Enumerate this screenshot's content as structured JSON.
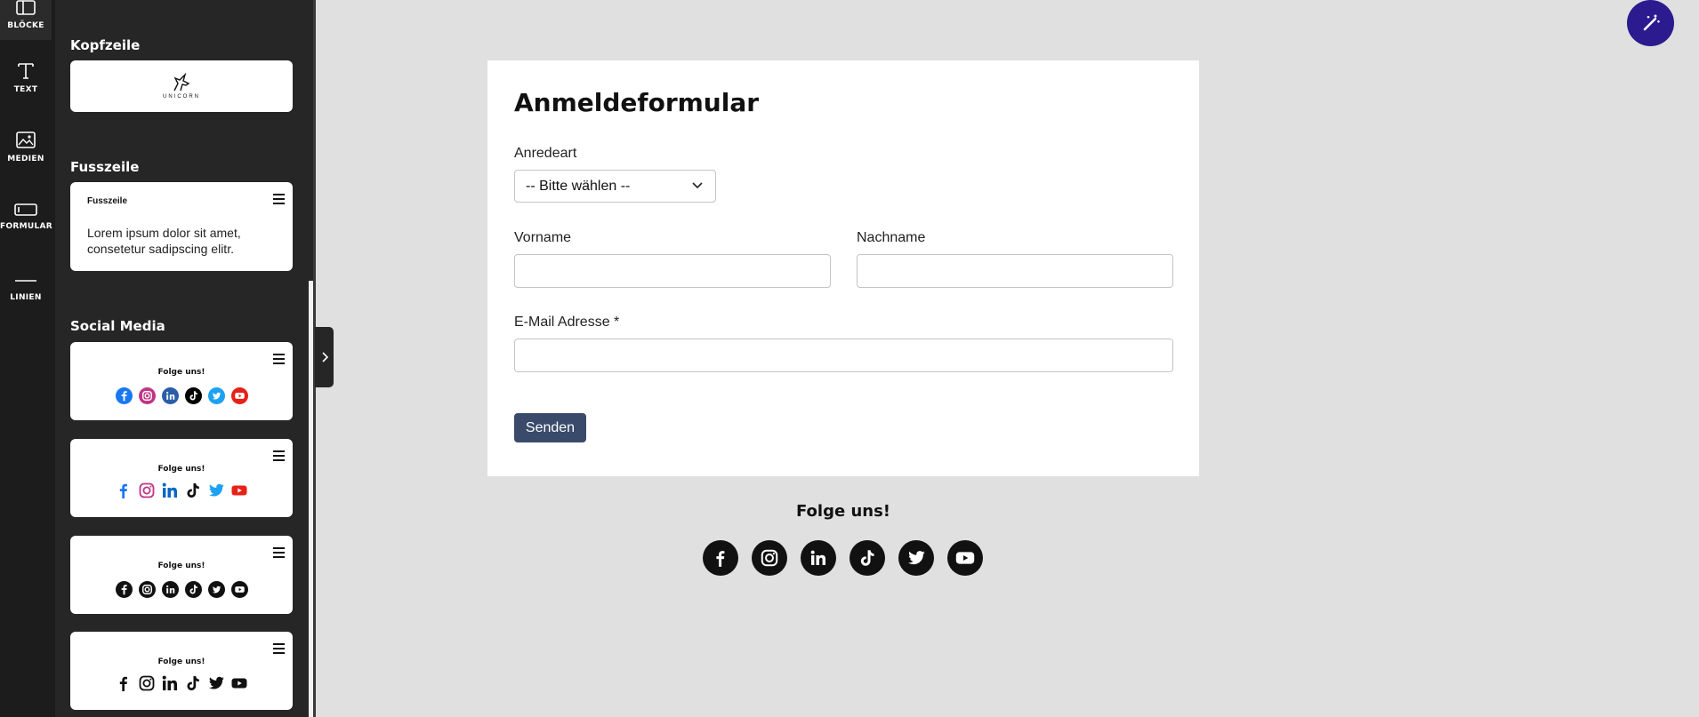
{
  "rail": {
    "items": [
      {
        "label": "BLÖCKE",
        "icon": "blocks-icon"
      },
      {
        "label": "TEXT",
        "icon": "text-icon"
      },
      {
        "label": "MEDIEN",
        "icon": "image-icon"
      },
      {
        "label": "FORMULAR",
        "icon": "form-icon"
      },
      {
        "label": "LINIEN",
        "icon": "line-icon"
      }
    ]
  },
  "panel": {
    "header_section": {
      "title": "Kopfzeile",
      "logo_text": "UNICORN"
    },
    "footer_section": {
      "title": "Fusszeile",
      "card_title": "Fusszeile",
      "card_text": "Lorem ipsum dolor sit amet, consetetur sadipscing elitr."
    },
    "social_section": {
      "title": "Social Media",
      "cards": [
        {
          "label": "Folge uns!",
          "style": "color-circle"
        },
        {
          "label": "Folge uns!",
          "style": "color-plain"
        },
        {
          "label": "Folge uns!",
          "style": "black-circle"
        },
        {
          "label": "Folge uns!",
          "style": "black-plain"
        }
      ]
    }
  },
  "form": {
    "title": "Anmeldeformular",
    "salutation_label": "Anredeart",
    "salutation_value": "-- Bitte wählen --",
    "firstname_label": "Vorname",
    "lastname_label": "Nachname",
    "email_label": "E-Mail Adresse *",
    "submit_label": "Senden"
  },
  "follow": {
    "title": "Folge uns!"
  },
  "colors": {
    "facebook": "#1877f2",
    "instagram": "#c13584",
    "linkedin": "#0a66c2",
    "tiktok": "#000000",
    "twitter": "#1da1f2",
    "youtube": "#e62117",
    "submit": "#3a4a6b",
    "magic_button": "#2c1a8f"
  }
}
